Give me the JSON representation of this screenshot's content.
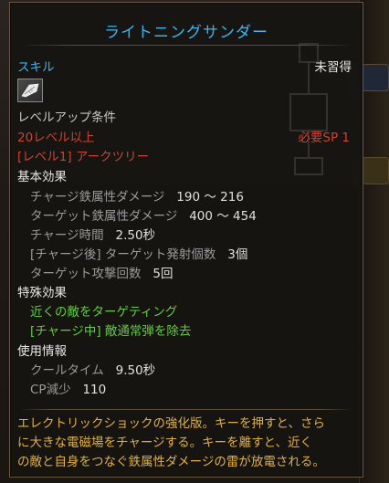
{
  "skill": {
    "title": "ライトニングサンダー",
    "category": "スキル",
    "learn_status": "未習得",
    "icon": "skill-feather-icon"
  },
  "levelup": {
    "heading": "レベルアップ条件",
    "level_req": "20レベル以上",
    "sp_req": "必要SP 1",
    "tree_req": "[レベル1] アークツリー"
  },
  "basic": {
    "heading": "基本効果",
    "stats": [
      {
        "label": "チャージ鉄属性ダメージ",
        "value": "190 ～ 216"
      },
      {
        "label": "ターゲット鉄属性ダメージ",
        "value": "400 ～ 454"
      },
      {
        "label": "チャージ時間",
        "value": "2.50秒"
      },
      {
        "label": "[チャージ後] ターゲット発射個数",
        "value": "3個"
      },
      {
        "label": "ターゲット攻撃回数",
        "value": "5回"
      }
    ]
  },
  "special": {
    "heading": "特殊効果",
    "effects": [
      "近くの敵をターゲティング",
      "[チャージ中] 敵通常弾を除去"
    ]
  },
  "usage": {
    "heading": "使用情報",
    "stats": [
      {
        "label": "クールタイム",
        "value": "9.50秒"
      },
      {
        "label": "CP減少",
        "value": "110"
      }
    ]
  },
  "description": [
    "エレクトリックショックの強化版。キーを押すと、さら",
    "に大きな電磁場をチャージする。キーを離すと、近く",
    "の敵と自身をつなぐ鉄属性ダメージの雷が放電される。"
  ],
  "colors": {
    "title": "#37b6f0",
    "requirement": "#d2402e",
    "effect": "#5fcf3a",
    "description": "#e0b040"
  }
}
